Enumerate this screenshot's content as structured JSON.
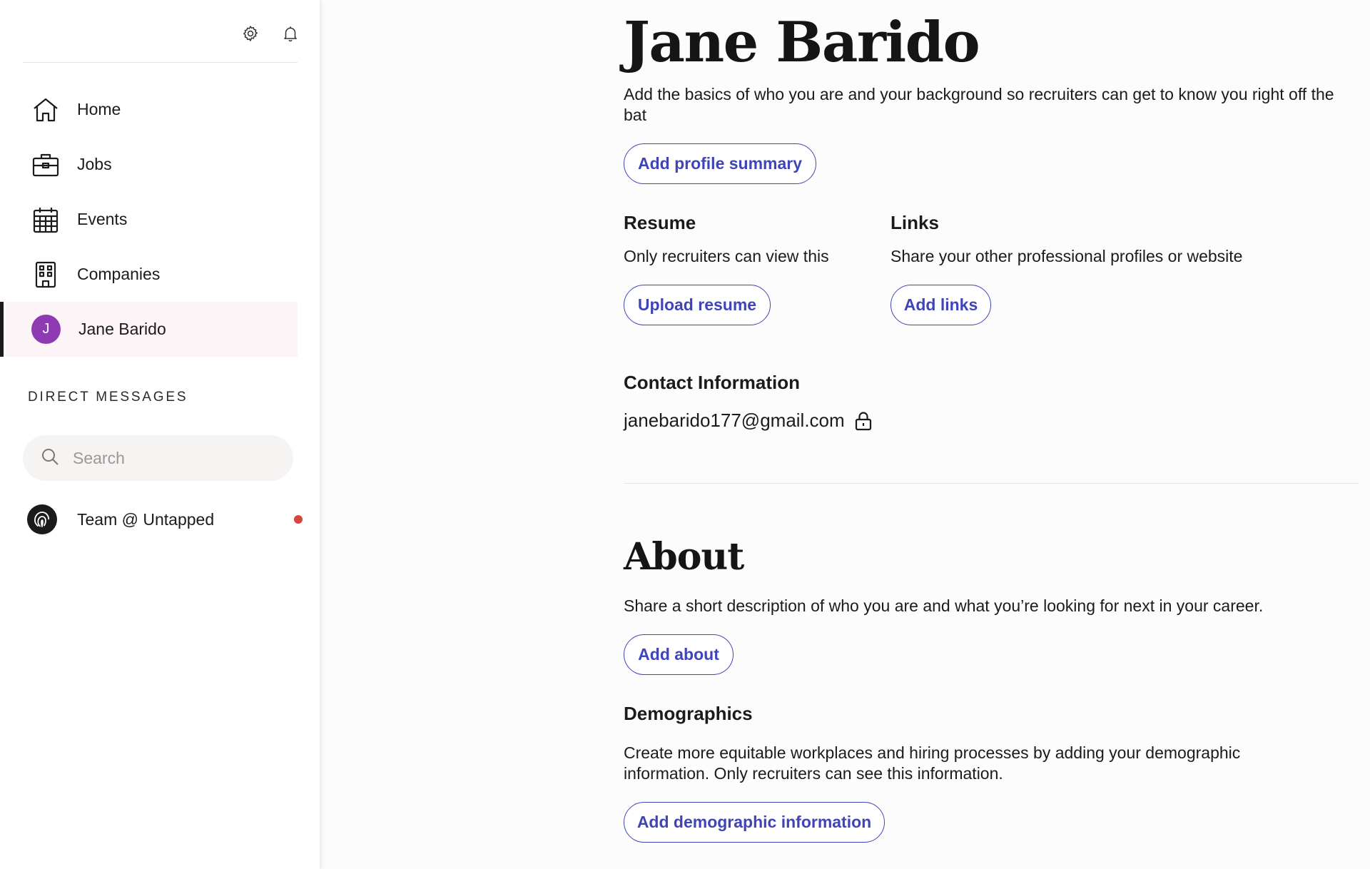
{
  "sidebar": {
    "top_icons": [
      "gear-icon",
      "bell-icon"
    ],
    "nav": [
      {
        "label": "Home",
        "icon": "home-icon"
      },
      {
        "label": "Jobs",
        "icon": "briefcase-icon"
      },
      {
        "label": "Events",
        "icon": "calendar-icon"
      },
      {
        "label": "Companies",
        "icon": "building-icon"
      },
      {
        "label": "Jane Barido",
        "icon": "avatar",
        "avatar_initial": "J",
        "active": true
      }
    ],
    "direct_messages_header": "DIRECT MESSAGES",
    "search_placeholder": "Search",
    "dm_items": [
      {
        "name": "Team @ Untapped",
        "icon": "untapped-logo-icon",
        "unread": true
      }
    ]
  },
  "profile": {
    "name": "Jane Barido",
    "subtitle": "Add the basics of who you are and your background so recruiters can get to know you right off the bat",
    "add_summary_label": "Add profile summary",
    "resume": {
      "heading": "Resume",
      "text": "Only recruiters can view this",
      "button": "Upload resume"
    },
    "links": {
      "heading": "Links",
      "text": "Share your other professional profiles or website",
      "button": "Add links"
    },
    "contact": {
      "heading": "Contact Information",
      "email": "janebarido177@gmail.com",
      "lock_icon": "lock-icon"
    }
  },
  "about": {
    "title": "About",
    "text": "Share a short description of who you are and what you’re looking for next in your career.",
    "button": "Add about"
  },
  "demographics": {
    "heading": "Demographics",
    "text": "Create more equitable workplaces and hiring processes by adding your demographic information. Only recruiters can see this information.",
    "button": "Add demographic information"
  },
  "colors": {
    "accent": "#3f45b8",
    "avatar": "#8e3bb3",
    "unread_dot": "#d9443b",
    "active_bg": "#fdf4f7"
  }
}
